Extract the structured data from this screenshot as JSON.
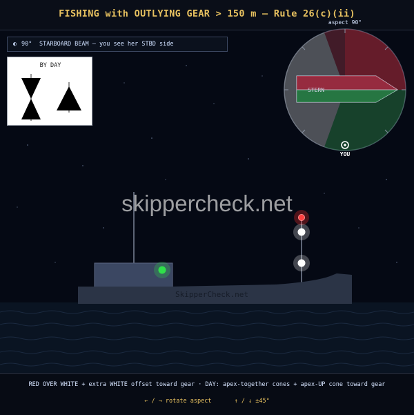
{
  "header": {
    "title": "FISHING with OUTLYING GEAR > 150 m — Rule 26(c)(ii)"
  },
  "aspect_banner": {
    "icon": "half-circle-icon",
    "angle": "90°",
    "text": "STARBOARD BEAM — you see her STBD side"
  },
  "day_shapes": {
    "title": "BY DAY"
  },
  "compass": {
    "aspect_label": "aspect 90°",
    "stern_label": "STERN",
    "you_label": "YOU",
    "colors": {
      "red": "#c81e32",
      "green": "#1e8c3a",
      "white": "#d8d8d8"
    }
  },
  "scene": {
    "watermark": "skippercheck.net",
    "hull_text": "SkipperCheck.net",
    "light_colors": {
      "red": "#ff3030",
      "green": "#2fe04a",
      "white": "#ffffff"
    }
  },
  "footer": {
    "caption": "RED OVER WHITE + extra WHITE offset toward gear · DAY: apex-together cones + apex-UP cone toward gear",
    "control_rotate": "← / →  rotate aspect",
    "control_step": "↑ / ↓  ±45°"
  }
}
